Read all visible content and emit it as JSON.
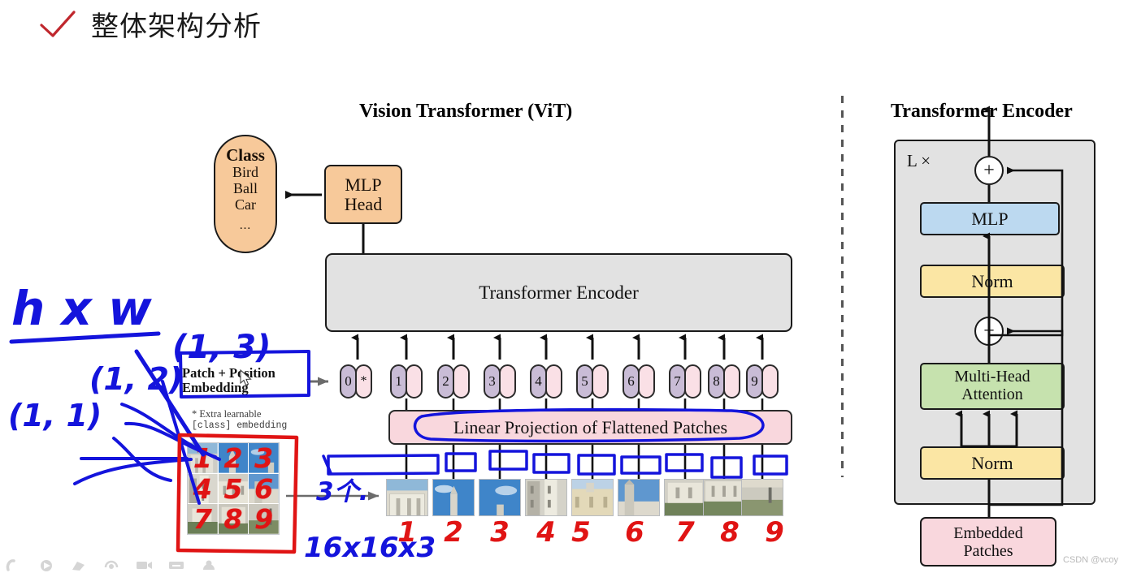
{
  "header": {
    "check_icon": "check-icon",
    "title": "整体架构分析"
  },
  "figure": {
    "left_title": "Vision Transformer (ViT)",
    "right_title": "Transformer Encoder"
  },
  "vit": {
    "class_box": {
      "heading": "Class",
      "items": [
        "Bird",
        "Ball",
        "Car"
      ],
      "ellipsis": "...",
      "fill": "#f7c99a"
    },
    "mlp_head": {
      "line1": "MLP",
      "line2": "Head",
      "fill": "#f7c99a"
    },
    "encoder_bar": {
      "label": "Transformer Encoder",
      "fill": "#e2e2e2"
    },
    "linear_projection": {
      "label": "Linear Projection of Flattened Patches",
      "fill": "#f9d7dd"
    },
    "patch_pos_label": {
      "line1": "Patch + Position",
      "line2": "Embedding"
    },
    "extra_note": {
      "line1": "* Extra learnable",
      "line2": "[class] embedding"
    },
    "tokens": [
      {
        "num": "0",
        "mark": "*"
      },
      {
        "num": "1",
        "mark": ""
      },
      {
        "num": "2",
        "mark": ""
      },
      {
        "num": "3",
        "mark": ""
      },
      {
        "num": "4",
        "mark": ""
      },
      {
        "num": "5",
        "mark": ""
      },
      {
        "num": "6",
        "mark": ""
      },
      {
        "num": "7",
        "mark": ""
      },
      {
        "num": "8",
        "mark": ""
      },
      {
        "num": "9",
        "mark": ""
      }
    ],
    "token_colors": {
      "number_pill": "#c9bcd6",
      "embedding_pill": "#fae0e6"
    },
    "patch_numbers": [
      "1",
      "2",
      "3",
      "4",
      "5",
      "6",
      "7",
      "8",
      "9"
    ],
    "source_grid_numbers": [
      "1",
      "2",
      "3",
      "4",
      "5",
      "6",
      "7",
      "8",
      "9"
    ]
  },
  "encoder": {
    "repeat_label": "L ×",
    "blocks": [
      {
        "label": "MLP",
        "fill": "#bcd9f0"
      },
      {
        "label": "Norm",
        "fill": "#fbe6a4"
      },
      {
        "label": "Multi-Head Attention",
        "line1": "Multi-Head",
        "line2": "Attention",
        "fill": "#c6e2ae"
      },
      {
        "label": "Norm",
        "fill": "#fbe6a4"
      }
    ],
    "embedded_patches": {
      "line1": "Embedded",
      "line2": "Patches",
      "fill": "#f9d7dd"
    },
    "adders": [
      "+",
      "+"
    ],
    "panel_fill": "#e2e2e2"
  },
  "annotations": {
    "ink_blue": "#1414dc",
    "ink_red": "#e01414",
    "handwritten": [
      {
        "name": "h-times-w",
        "text": "h x w"
      },
      {
        "name": "coord-1-3",
        "text": "(1, 3)"
      },
      {
        "name": "coord-1-2",
        "text": "(1, 2)"
      },
      {
        "name": "coord-1-1",
        "text": "(1, 1)"
      },
      {
        "name": "three-ge",
        "text": "3个."
      },
      {
        "name": "patch-size",
        "text": "16x16x3"
      }
    ]
  },
  "watermark": {
    "text": "CSDN @vcoy"
  },
  "toolbar": {
    "icons": [
      "pen-icon",
      "cursor-icon",
      "eraser-icon",
      "shapes-icon",
      "video-icon",
      "rectangle-icon",
      "more-icon"
    ]
  }
}
